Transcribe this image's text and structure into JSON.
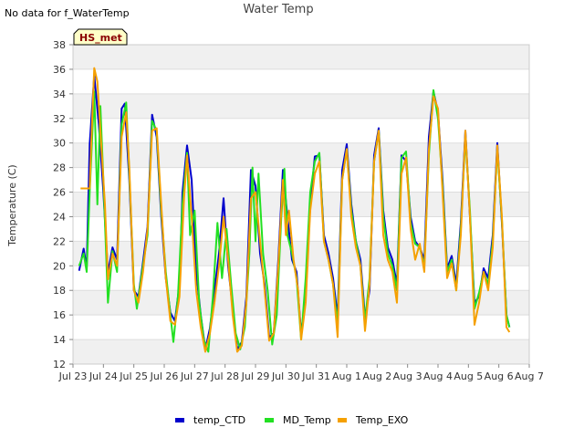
{
  "header": {
    "note": "No data for f_WaterTemp",
    "badge": "HS_met"
  },
  "chart_data": {
    "type": "line",
    "title": "Water Temp",
    "xlabel": "",
    "ylabel": "Temperature (C)",
    "x_ticks": [
      "Jul 23",
      "Jul 24",
      "Jul 25",
      "Jul 26",
      "Jul 27",
      "Jul 28",
      "Jul 29",
      "Jul 30",
      "Jul 31",
      "Aug 1",
      "Aug 2",
      "Aug 3",
      "Aug 4",
      "Aug 5",
      "Aug 6",
      "Aug 7"
    ],
    "xlim": [
      0,
      15
    ],
    "ylim": [
      12,
      38
    ],
    "y_ticks": [
      12,
      14,
      16,
      18,
      20,
      22,
      24,
      26,
      28,
      30,
      32,
      34,
      36,
      38
    ],
    "grid": "horizontal bands",
    "legend_position": "bottom",
    "series": [
      {
        "name": "temp_CTD",
        "color": "#0000cc",
        "points": [
          [
            0.2,
            19.6
          ],
          [
            0.35,
            21.4
          ],
          [
            0.45,
            19.8
          ],
          [
            0.55,
            29.9
          ],
          [
            0.7,
            35.5
          ],
          [
            0.85,
            31.5
          ],
          [
            1.0,
            26.0
          ],
          [
            1.15,
            19.4
          ],
          [
            1.3,
            21.5
          ],
          [
            1.45,
            20.5
          ],
          [
            1.6,
            32.8
          ],
          [
            1.7,
            33.2
          ],
          [
            1.85,
            27.0
          ],
          [
            2.0,
            18.0
          ],
          [
            2.15,
            17.5
          ],
          [
            2.3,
            20.3
          ],
          [
            2.45,
            23.2
          ],
          [
            2.6,
            32.3
          ],
          [
            2.75,
            30.5
          ],
          [
            2.9,
            24.0
          ],
          [
            3.05,
            19.0
          ],
          [
            3.2,
            16.2
          ],
          [
            3.35,
            15.5
          ],
          [
            3.5,
            18.5
          ],
          [
            3.6,
            26.0
          ],
          [
            3.75,
            29.8
          ],
          [
            3.9,
            27.0
          ],
          [
            4.05,
            19.5
          ],
          [
            4.2,
            16.0
          ],
          [
            4.35,
            13.2
          ],
          [
            4.5,
            14.9
          ],
          [
            4.65,
            18.0
          ],
          [
            4.8,
            21.0
          ],
          [
            4.95,
            25.5
          ],
          [
            5.1,
            20.0
          ],
          [
            5.25,
            16.5
          ],
          [
            5.4,
            13.2
          ],
          [
            5.55,
            13.8
          ],
          [
            5.7,
            17.5
          ],
          [
            5.85,
            27.8
          ],
          [
            6.0,
            26.5
          ],
          [
            6.15,
            21.0
          ],
          [
            6.3,
            18.5
          ],
          [
            6.45,
            14.2
          ],
          [
            6.6,
            14.5
          ],
          [
            6.75,
            20.5
          ],
          [
            6.9,
            27.8
          ],
          [
            7.05,
            24.0
          ],
          [
            7.2,
            20.5
          ],
          [
            7.35,
            19.5
          ],
          [
            7.5,
            14.5
          ],
          [
            7.65,
            17.5
          ],
          [
            7.8,
            25.0
          ],
          [
            7.95,
            28.9
          ],
          [
            8.1,
            29.0
          ],
          [
            8.25,
            22.5
          ],
          [
            8.4,
            21.0
          ],
          [
            8.55,
            19.0
          ],
          [
            8.7,
            15.8
          ],
          [
            8.85,
            27.8
          ],
          [
            9.0,
            29.9
          ],
          [
            9.15,
            25.0
          ],
          [
            9.3,
            22.0
          ],
          [
            9.45,
            20.5
          ],
          [
            9.6,
            15.8
          ],
          [
            9.75,
            18.0
          ],
          [
            9.9,
            29.0
          ],
          [
            10.05,
            31.2
          ],
          [
            10.2,
            24.5
          ],
          [
            10.35,
            21.5
          ],
          [
            10.5,
            20.5
          ],
          [
            10.65,
            18.5
          ],
          [
            10.8,
            29.0
          ],
          [
            10.95,
            28.5
          ],
          [
            11.1,
            24.0
          ],
          [
            11.25,
            22.0
          ],
          [
            11.4,
            21.5
          ],
          [
            11.55,
            20.5
          ],
          [
            11.7,
            30.5
          ],
          [
            11.85,
            34.2
          ],
          [
            12.0,
            32.5
          ],
          [
            12.15,
            27.0
          ],
          [
            12.3,
            19.8
          ],
          [
            12.45,
            20.8
          ],
          [
            12.6,
            18.5
          ],
          [
            12.75,
            23.5
          ],
          [
            12.9,
            31.0
          ],
          [
            13.05,
            24.0
          ],
          [
            13.2,
            17.0
          ],
          [
            13.35,
            17.5
          ],
          [
            13.5,
            19.8
          ],
          [
            13.65,
            19.0
          ],
          [
            13.8,
            22.5
          ],
          [
            13.95,
            30.0
          ],
          [
            14.1,
            23.5
          ],
          [
            14.25,
            16.0
          ],
          [
            14.35,
            15.0
          ]
        ]
      },
      {
        "name": "MD_Temp",
        "color": "#22e022",
        "points": [
          [
            0.2,
            20.0
          ],
          [
            0.35,
            21.0
          ],
          [
            0.45,
            19.5
          ],
          [
            0.55,
            26.0
          ],
          [
            0.7,
            34.2
          ],
          [
            0.8,
            25.0
          ],
          [
            0.9,
            33.0
          ],
          [
            1.0,
            27.0
          ],
          [
            1.15,
            17.0
          ],
          [
            1.3,
            21.2
          ],
          [
            1.45,
            19.5
          ],
          [
            1.6,
            31.5
          ],
          [
            1.75,
            33.3
          ],
          [
            1.85,
            27.5
          ],
          [
            2.0,
            18.5
          ],
          [
            2.1,
            16.5
          ],
          [
            2.3,
            20.0
          ],
          [
            2.45,
            22.5
          ],
          [
            2.6,
            31.8
          ],
          [
            2.75,
            31.0
          ],
          [
            2.9,
            24.5
          ],
          [
            3.05,
            19.5
          ],
          [
            3.2,
            16.0
          ],
          [
            3.3,
            13.8
          ],
          [
            3.45,
            17.5
          ],
          [
            3.6,
            25.0
          ],
          [
            3.75,
            29.2
          ],
          [
            3.85,
            22.5
          ],
          [
            4.0,
            24.5
          ],
          [
            4.15,
            17.0
          ],
          [
            4.3,
            14.0
          ],
          [
            4.45,
            13.0
          ],
          [
            4.6,
            17.5
          ],
          [
            4.75,
            23.5
          ],
          [
            4.9,
            19.0
          ],
          [
            5.05,
            23.0
          ],
          [
            5.2,
            18.5
          ],
          [
            5.35,
            14.5
          ],
          [
            5.5,
            13.2
          ],
          [
            5.65,
            15.0
          ],
          [
            5.8,
            21.0
          ],
          [
            5.9,
            28.0
          ],
          [
            6.0,
            22.0
          ],
          [
            6.1,
            27.5
          ],
          [
            6.25,
            21.0
          ],
          [
            6.4,
            18.0
          ],
          [
            6.55,
            13.6
          ],
          [
            6.7,
            16.0
          ],
          [
            6.85,
            24.0
          ],
          [
            6.95,
            27.9
          ],
          [
            7.05,
            22.5
          ],
          [
            7.2,
            21.0
          ],
          [
            7.35,
            19.0
          ],
          [
            7.5,
            14.0
          ],
          [
            7.65,
            19.0
          ],
          [
            7.8,
            26.0
          ],
          [
            7.95,
            28.5
          ],
          [
            8.1,
            29.2
          ],
          [
            8.25,
            22.0
          ],
          [
            8.4,
            20.5
          ],
          [
            8.55,
            18.5
          ],
          [
            8.7,
            15.2
          ],
          [
            8.85,
            27.0
          ],
          [
            9.0,
            29.5
          ],
          [
            9.15,
            24.5
          ],
          [
            9.3,
            22.0
          ],
          [
            9.45,
            20.0
          ],
          [
            9.6,
            15.5
          ],
          [
            9.75,
            19.0
          ],
          [
            9.9,
            28.5
          ],
          [
            10.05,
            31.0
          ],
          [
            10.2,
            24.0
          ],
          [
            10.35,
            21.0
          ],
          [
            10.5,
            20.0
          ],
          [
            10.65,
            18.0
          ],
          [
            10.8,
            28.8
          ],
          [
            10.95,
            29.3
          ],
          [
            11.1,
            23.5
          ],
          [
            11.25,
            21.8
          ],
          [
            11.4,
            21.5
          ],
          [
            11.55,
            20.0
          ],
          [
            11.7,
            29.0
          ],
          [
            11.85,
            34.3
          ],
          [
            12.0,
            32.0
          ],
          [
            12.15,
            26.5
          ],
          [
            12.3,
            19.5
          ],
          [
            12.45,
            20.5
          ],
          [
            12.6,
            18.0
          ],
          [
            12.75,
            23.0
          ],
          [
            12.9,
            30.5
          ],
          [
            13.05,
            24.5
          ],
          [
            13.2,
            16.5
          ],
          [
            13.35,
            17.8
          ],
          [
            13.5,
            19.5
          ],
          [
            13.65,
            18.5
          ],
          [
            13.8,
            22.0
          ],
          [
            13.95,
            29.5
          ],
          [
            14.1,
            23.8
          ],
          [
            14.25,
            16.0
          ],
          [
            14.35,
            15.0
          ]
        ]
      },
      {
        "name": "Temp_EXO",
        "color": "#f5a000",
        "points": [
          [
            0.25,
            26.3
          ],
          [
            0.55,
            26.3
          ],
          [
            0.6,
            30.0
          ],
          [
            0.7,
            36.1
          ],
          [
            0.8,
            35.0
          ],
          [
            0.9,
            31.0
          ],
          [
            1.05,
            25.0
          ],
          [
            1.15,
            18.9
          ],
          [
            1.3,
            21.0
          ],
          [
            1.45,
            20.0
          ],
          [
            1.6,
            30.5
          ],
          [
            1.75,
            32.5
          ],
          [
            1.85,
            28.0
          ],
          [
            2.0,
            18.0
          ],
          [
            2.15,
            17.0
          ],
          [
            2.3,
            19.5
          ],
          [
            2.45,
            23.0
          ],
          [
            2.6,
            31.0
          ],
          [
            2.75,
            31.2
          ],
          [
            2.9,
            25.0
          ],
          [
            3.05,
            19.0
          ],
          [
            3.2,
            15.5
          ],
          [
            3.35,
            15.2
          ],
          [
            3.5,
            17.5
          ],
          [
            3.65,
            25.5
          ],
          [
            3.75,
            29.0
          ],
          [
            3.9,
            24.0
          ],
          [
            4.05,
            18.0
          ],
          [
            4.2,
            15.0
          ],
          [
            4.35,
            13.0
          ],
          [
            4.5,
            14.5
          ],
          [
            4.65,
            17.0
          ],
          [
            4.8,
            20.0
          ],
          [
            4.95,
            24.0
          ],
          [
            5.1,
            20.5
          ],
          [
            5.25,
            16.0
          ],
          [
            5.4,
            13.0
          ],
          [
            5.55,
            13.5
          ],
          [
            5.7,
            17.0
          ],
          [
            5.85,
            25.5
          ],
          [
            6.0,
            26.0
          ],
          [
            6.15,
            22.0
          ],
          [
            6.3,
            18.0
          ],
          [
            6.45,
            13.9
          ],
          [
            6.6,
            14.5
          ],
          [
            6.75,
            20.0
          ],
          [
            6.9,
            27.0
          ],
          [
            7.0,
            22.5
          ],
          [
            7.1,
            24.5
          ],
          [
            7.25,
            20.5
          ],
          [
            7.4,
            18.0
          ],
          [
            7.5,
            14.0
          ],
          [
            7.65,
            17.0
          ],
          [
            7.8,
            24.5
          ],
          [
            7.95,
            27.5
          ],
          [
            8.1,
            28.5
          ],
          [
            8.25,
            22.0
          ],
          [
            8.4,
            20.5
          ],
          [
            8.55,
            18.5
          ],
          [
            8.7,
            14.2
          ],
          [
            8.85,
            27.0
          ],
          [
            9.0,
            29.5
          ],
          [
            9.15,
            24.0
          ],
          [
            9.3,
            21.5
          ],
          [
            9.45,
            20.0
          ],
          [
            9.6,
            14.7
          ],
          [
            9.75,
            18.5
          ],
          [
            9.9,
            28.5
          ],
          [
            10.05,
            31.0
          ],
          [
            10.2,
            22.5
          ],
          [
            10.35,
            20.5
          ],
          [
            10.5,
            19.5
          ],
          [
            10.65,
            17.0
          ],
          [
            10.8,
            27.5
          ],
          [
            10.95,
            28.8
          ],
          [
            11.1,
            23.0
          ],
          [
            11.25,
            20.5
          ],
          [
            11.4,
            21.8
          ],
          [
            11.55,
            19.5
          ],
          [
            11.7,
            29.5
          ],
          [
            11.85,
            33.8
          ],
          [
            12.0,
            32.8
          ],
          [
            12.15,
            26.0
          ],
          [
            12.3,
            19.0
          ],
          [
            12.45,
            20.2
          ],
          [
            12.6,
            18.0
          ],
          [
            12.75,
            22.5
          ],
          [
            12.9,
            31.0
          ],
          [
            13.05,
            24.0
          ],
          [
            13.2,
            15.2
          ],
          [
            13.35,
            17.0
          ],
          [
            13.5,
            19.5
          ],
          [
            13.65,
            18.0
          ],
          [
            13.8,
            21.5
          ],
          [
            13.95,
            29.8
          ],
          [
            14.1,
            24.0
          ],
          [
            14.25,
            15.0
          ],
          [
            14.35,
            14.6
          ]
        ]
      }
    ]
  }
}
